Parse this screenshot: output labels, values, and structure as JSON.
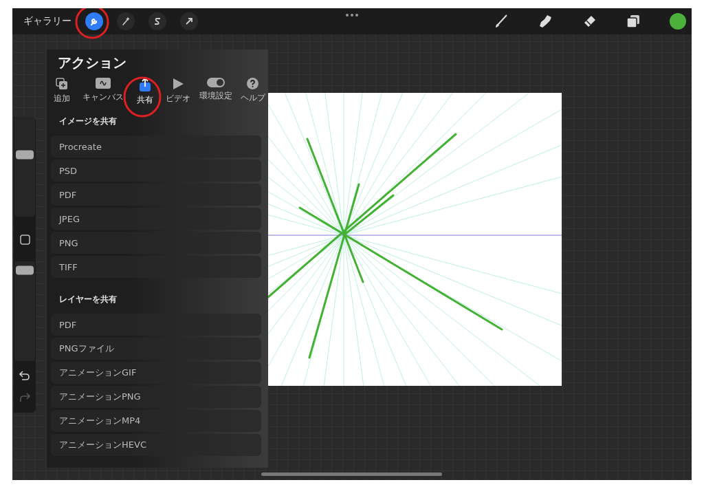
{
  "top_bar": {
    "gallery": "ギャラリー",
    "tools": [
      {
        "selected": true
      },
      {
        "selected": false
      },
      {
        "selected": false
      },
      {
        "selected": false
      }
    ]
  },
  "sidebar": {
    "sliders": [
      {
        "level": 0.62
      },
      {
        "level": 0.91
      }
    ]
  },
  "actions_panel": {
    "title": "アクション",
    "tabs": [
      {
        "label": "追加",
        "selected": false
      },
      {
        "label": "キャンバス",
        "selected": false
      },
      {
        "label": "共有",
        "selected": true
      },
      {
        "label": "ビデオ",
        "selected": false
      },
      {
        "label": "環境設定",
        "selected": false
      },
      {
        "label": "ヘルプ",
        "selected": false
      }
    ],
    "sections": [
      {
        "heading": "イメージを共有",
        "items": [
          "Procreate",
          "PSD",
          "PDF",
          "JPEG",
          "PNG",
          "TIFF"
        ]
      },
      {
        "heading": "レイヤーを共有",
        "items": [
          "PDF",
          "PNGファイル",
          "アニメーションGIF",
          "アニメーションPNG",
          "アニメーションMP4",
          "アニメーションHEVC"
        ]
      }
    ]
  }
}
